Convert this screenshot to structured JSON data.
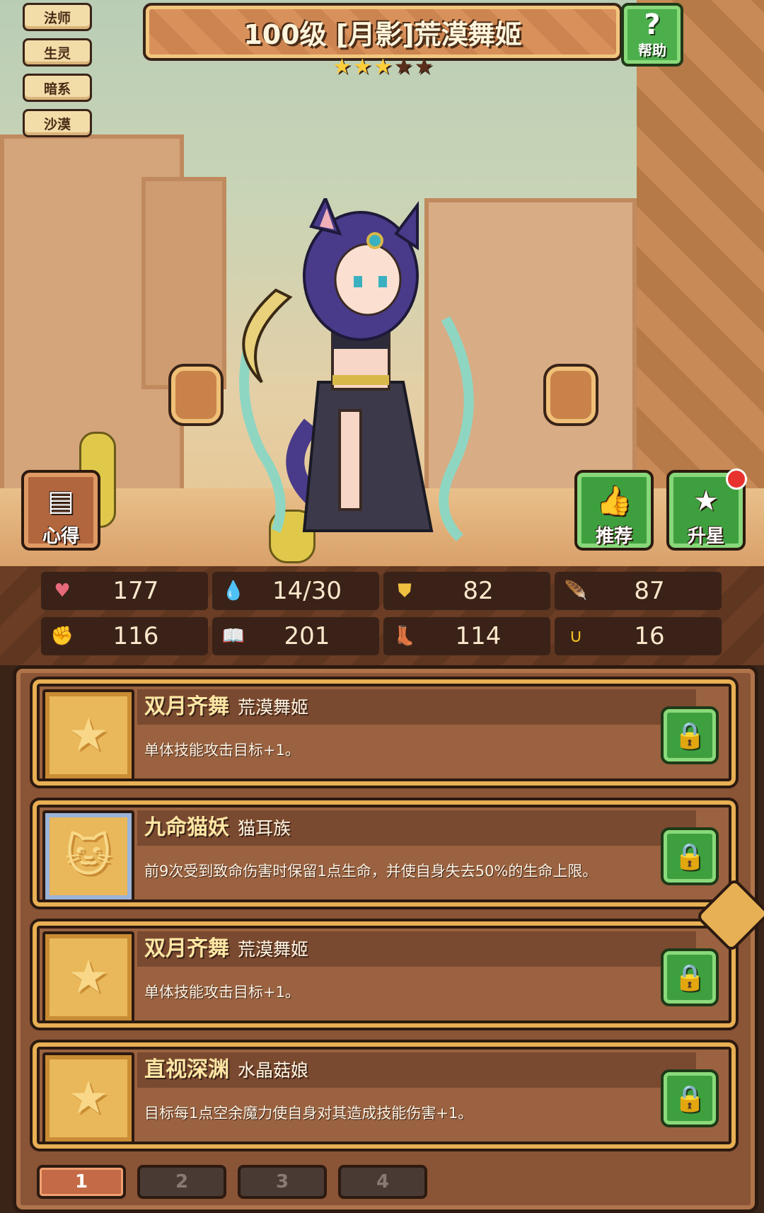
{
  "tags": [
    "法师",
    "生灵",
    "暗系",
    "沙漠"
  ],
  "title": "100级 [月影]荒漠舞姬",
  "stars": {
    "filled": 3,
    "total": 5
  },
  "help": {
    "icon": "?",
    "label": "帮助"
  },
  "buttons": {
    "notes": "心得",
    "recommend": "推荐",
    "star_up": "升星"
  },
  "stats": [
    {
      "icon": "heart-icon",
      "glyph": "♥",
      "color": "#e86a7a",
      "value": "177"
    },
    {
      "icon": "water-drop-icon",
      "glyph": "💧",
      "color": "#6ac8f0",
      "value": "14/30"
    },
    {
      "icon": "shield-icon",
      "glyph": "⛊",
      "color": "#f0c040",
      "value": "82"
    },
    {
      "icon": "feather-icon",
      "glyph": "🪶",
      "color": "#e0e8f0",
      "value": "87"
    },
    {
      "icon": "fist-icon",
      "glyph": "✊",
      "color": "#e88a7a",
      "value": "116"
    },
    {
      "icon": "book-icon",
      "glyph": "📖",
      "color": "#e0e0e0",
      "value": "201"
    },
    {
      "icon": "boots-icon",
      "glyph": "👢",
      "color": "#6ab0f0",
      "value": "114"
    },
    {
      "icon": "horseshoe-icon",
      "glyph": "∪",
      "color": "#f0c020",
      "value": "16"
    }
  ],
  "skills": [
    {
      "name": "双月齐舞",
      "source": "荒漠舞姬",
      "desc": "单体技能攻击目标+1。",
      "icon": "star-icon"
    },
    {
      "name": "九命猫妖",
      "source": "猫耳族",
      "desc": "前9次受到致命伤害时保留1点生命，并使自身失去50%的生命上限。",
      "icon": "cat-icon"
    },
    {
      "name": "双月齐舞",
      "source": "荒漠舞姬",
      "desc": "单体技能攻击目标+1。",
      "icon": "star-icon"
    },
    {
      "name": "直视深渊",
      "source": "水晶菇娘",
      "desc": "目标每1点空余魔力使自身对其造成技能伤害+1。",
      "icon": "star-icon"
    }
  ],
  "pages": [
    "1",
    "2",
    "3",
    "4"
  ],
  "active_page": "1"
}
